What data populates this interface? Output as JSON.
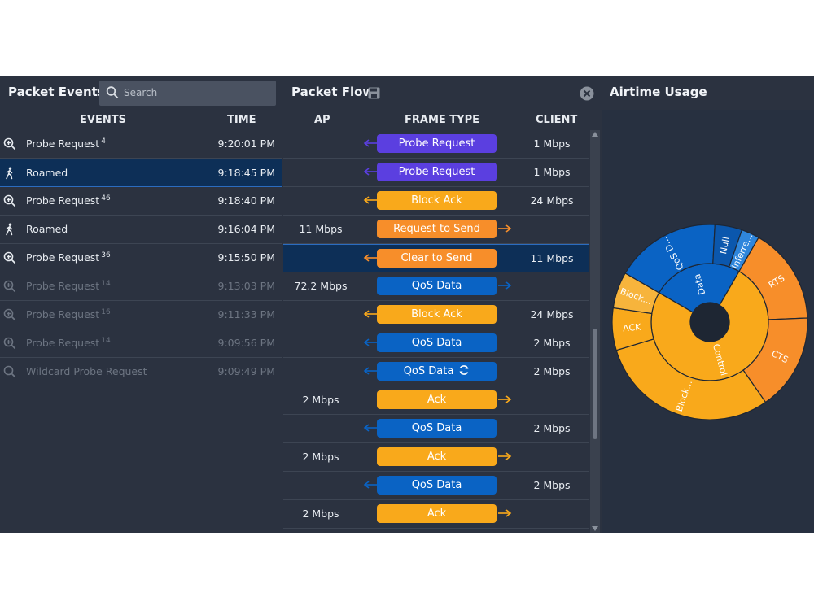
{
  "colors": {
    "purple": "#5b3fe0",
    "orange": "#f9a91b",
    "deep_orange": "#f78e2a",
    "blue": "#0a63c4",
    "selected": "#0d2f57"
  },
  "packet_events": {
    "title": "Packet Events",
    "search_placeholder": "Search",
    "columns": {
      "events": "EVENTS",
      "time": "TIME"
    },
    "rows": [
      {
        "name": "Probe Request",
        "count": "4",
        "time": "9:20:01 PM",
        "icon": "zoom-in-icon"
      },
      {
        "name": "Roamed",
        "count": "",
        "time": "9:18:45 PM",
        "icon": "walking-person-icon"
      },
      {
        "name": "Probe Request",
        "count": "46",
        "time": "9:18:40 PM",
        "icon": "zoom-in-icon"
      },
      {
        "name": "Roamed",
        "count": "",
        "time": "9:16:04 PM",
        "icon": "walking-person-icon"
      },
      {
        "name": "Probe Request",
        "count": "36",
        "time": "9:15:50 PM",
        "icon": "zoom-in-icon"
      },
      {
        "name": "Probe Request",
        "count": "14",
        "time": "9:13:03 PM",
        "icon": "zoom-in-icon"
      },
      {
        "name": "Probe Request",
        "count": "16",
        "time": "9:11:33 PM",
        "icon": "zoom-in-icon"
      },
      {
        "name": "Probe Request",
        "count": "14",
        "time": "9:09:56 PM",
        "icon": "zoom-in-icon"
      },
      {
        "name": "Wildcard Probe Request",
        "count": "",
        "time": "9:09:49 PM",
        "icon": "search-icon"
      }
    ]
  },
  "packet_flow": {
    "title": "Packet Flow",
    "columns": {
      "ap": "AP",
      "frame_type": "FRAME TYPE",
      "client": "CLIENT"
    },
    "rows": [
      {
        "ap": "",
        "frame": "Probe Request",
        "client": "1 Mbps",
        "color": "#5b3fe0",
        "direction": "left"
      },
      {
        "ap": "",
        "frame": "Probe Request",
        "client": "1 Mbps",
        "color": "#5b3fe0",
        "direction": "left"
      },
      {
        "ap": "",
        "frame": "Block Ack",
        "client": "24 Mbps",
        "color": "#f9a91b",
        "direction": "left"
      },
      {
        "ap": "11 Mbps",
        "frame": "Request to Send",
        "client": "",
        "color": "#f78e2a",
        "direction": "right"
      },
      {
        "ap": "",
        "frame": "Clear to Send",
        "client": "11 Mbps",
        "color": "#f78e2a",
        "direction": "left"
      },
      {
        "ap": "72.2 Mbps",
        "frame": "QoS Data",
        "client": "",
        "color": "#0a63c4",
        "direction": "right"
      },
      {
        "ap": "",
        "frame": "Block Ack",
        "client": "24 Mbps",
        "color": "#f9a91b",
        "direction": "left"
      },
      {
        "ap": "",
        "frame": "QoS Data",
        "client": "2 Mbps",
        "color": "#0a63c4",
        "direction": "left"
      },
      {
        "ap": "",
        "frame": "QoS Data",
        "client": "2 Mbps",
        "color": "#0a63c4",
        "direction": "left",
        "retry": true
      },
      {
        "ap": "2 Mbps",
        "frame": "Ack",
        "client": "",
        "color": "#f9a91b",
        "direction": "right"
      },
      {
        "ap": "",
        "frame": "QoS Data",
        "client": "2 Mbps",
        "color": "#0a63c4",
        "direction": "left"
      },
      {
        "ap": "2 Mbps",
        "frame": "Ack",
        "client": "",
        "color": "#f9a91b",
        "direction": "right"
      },
      {
        "ap": "",
        "frame": "QoS Data",
        "client": "2 Mbps",
        "color": "#0a63c4",
        "direction": "left"
      },
      {
        "ap": "2 Mbps",
        "frame": "Ack",
        "client": "",
        "color": "#f9a91b",
        "direction": "right"
      }
    ]
  },
  "airtime": {
    "title": "Airtime Usage",
    "chart_data": {
      "type": "sunburst",
      "inner": [
        {
          "name": "Data",
          "value": 25,
          "color": "#0a63c4"
        },
        {
          "name": "Control",
          "value": 75,
          "color": "#f9a91b"
        }
      ],
      "outer": [
        {
          "name": "QoS D...",
          "value": 17.5,
          "color": "#0a63c4",
          "parent": "Data"
        },
        {
          "name": "Null",
          "value": 4.5,
          "color": "#0b57ad",
          "parent": "Data"
        },
        {
          "name": "Inferre...",
          "value": 3,
          "color": "#2f86dc",
          "parent": "Data"
        },
        {
          "name": "RTS",
          "value": 16,
          "color": "#f78e2a",
          "parent": "Control"
        },
        {
          "name": "CTS",
          "value": 16,
          "color": "#f78e2a",
          "parent": "Control"
        },
        {
          "name": "Block...",
          "value": 30,
          "color": "#f9a91b",
          "parent": "Control"
        },
        {
          "name": "ACK",
          "value": 7,
          "color": "#f9a91b",
          "parent": "Control"
        },
        {
          "name": "Block...",
          "value": 6,
          "color": "#f7b43c",
          "parent": "Control"
        }
      ]
    }
  }
}
